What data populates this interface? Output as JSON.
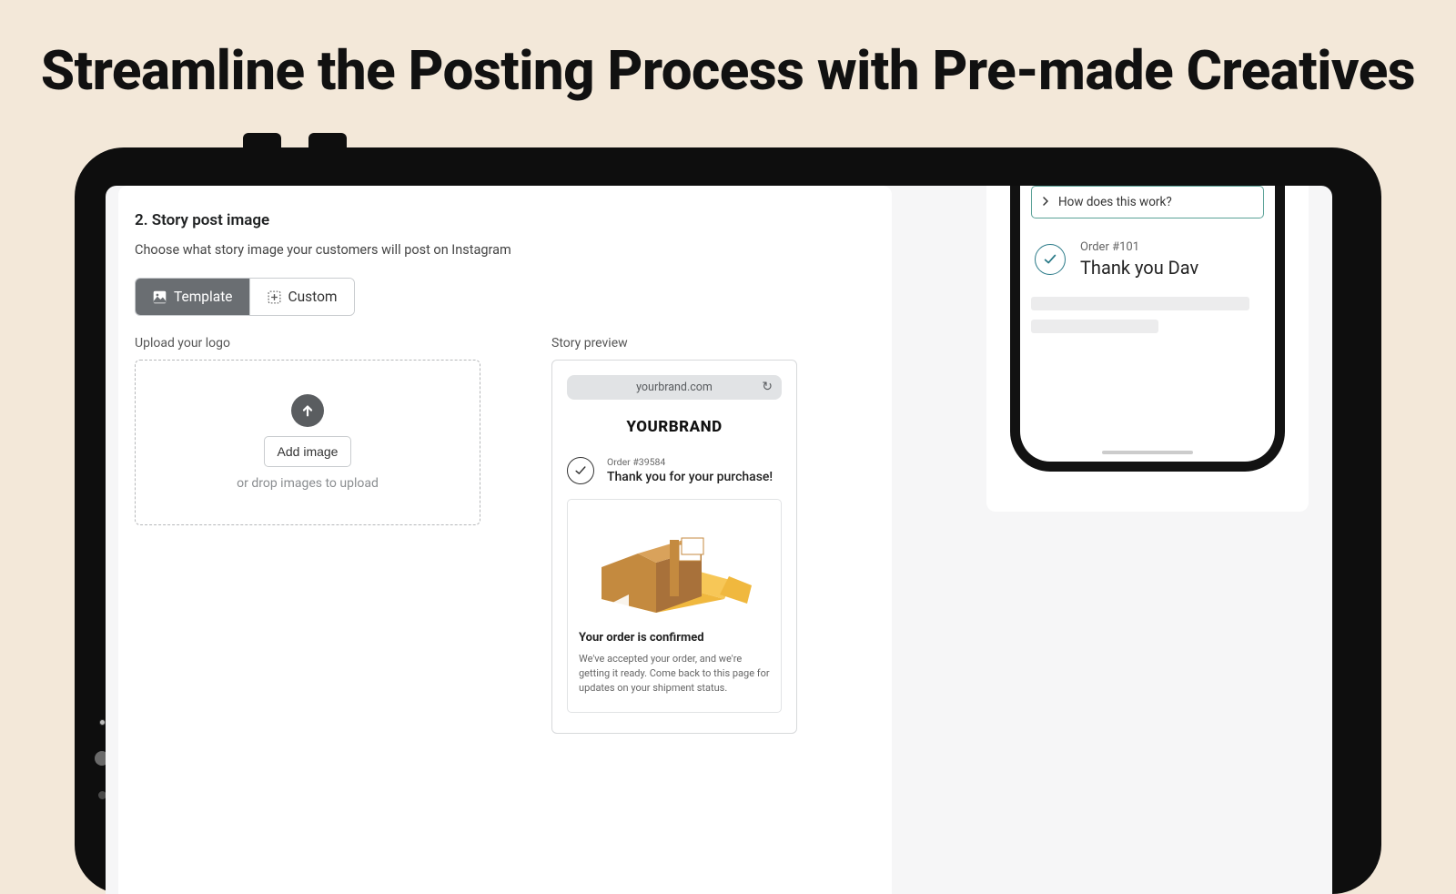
{
  "hero": {
    "title": "Streamline the Posting Process with Pre-made Creatives"
  },
  "section": {
    "title": "2. Story post image",
    "subtitle": "Choose what story image your customers will post on Instagram"
  },
  "tabs": {
    "template": "Template",
    "custom": "Custom"
  },
  "upload": {
    "label": "Upload your logo",
    "button": "Add image",
    "drop_text": "or drop images to upload"
  },
  "preview": {
    "label": "Story preview",
    "url": "yourbrand.com",
    "brand": "YOURBRAND",
    "order_number": "Order #39584",
    "thank_you": "Thank you for your purchase!",
    "confirmed_title": "Your order is confirmed",
    "confirmed_body": "We've accepted your order, and we're getting it ready. Come back to this page for updates on your shipment status."
  },
  "phone": {
    "how_does": "How does this work?",
    "order_number": "Order #101",
    "thank_you": "Thank you Dav"
  }
}
